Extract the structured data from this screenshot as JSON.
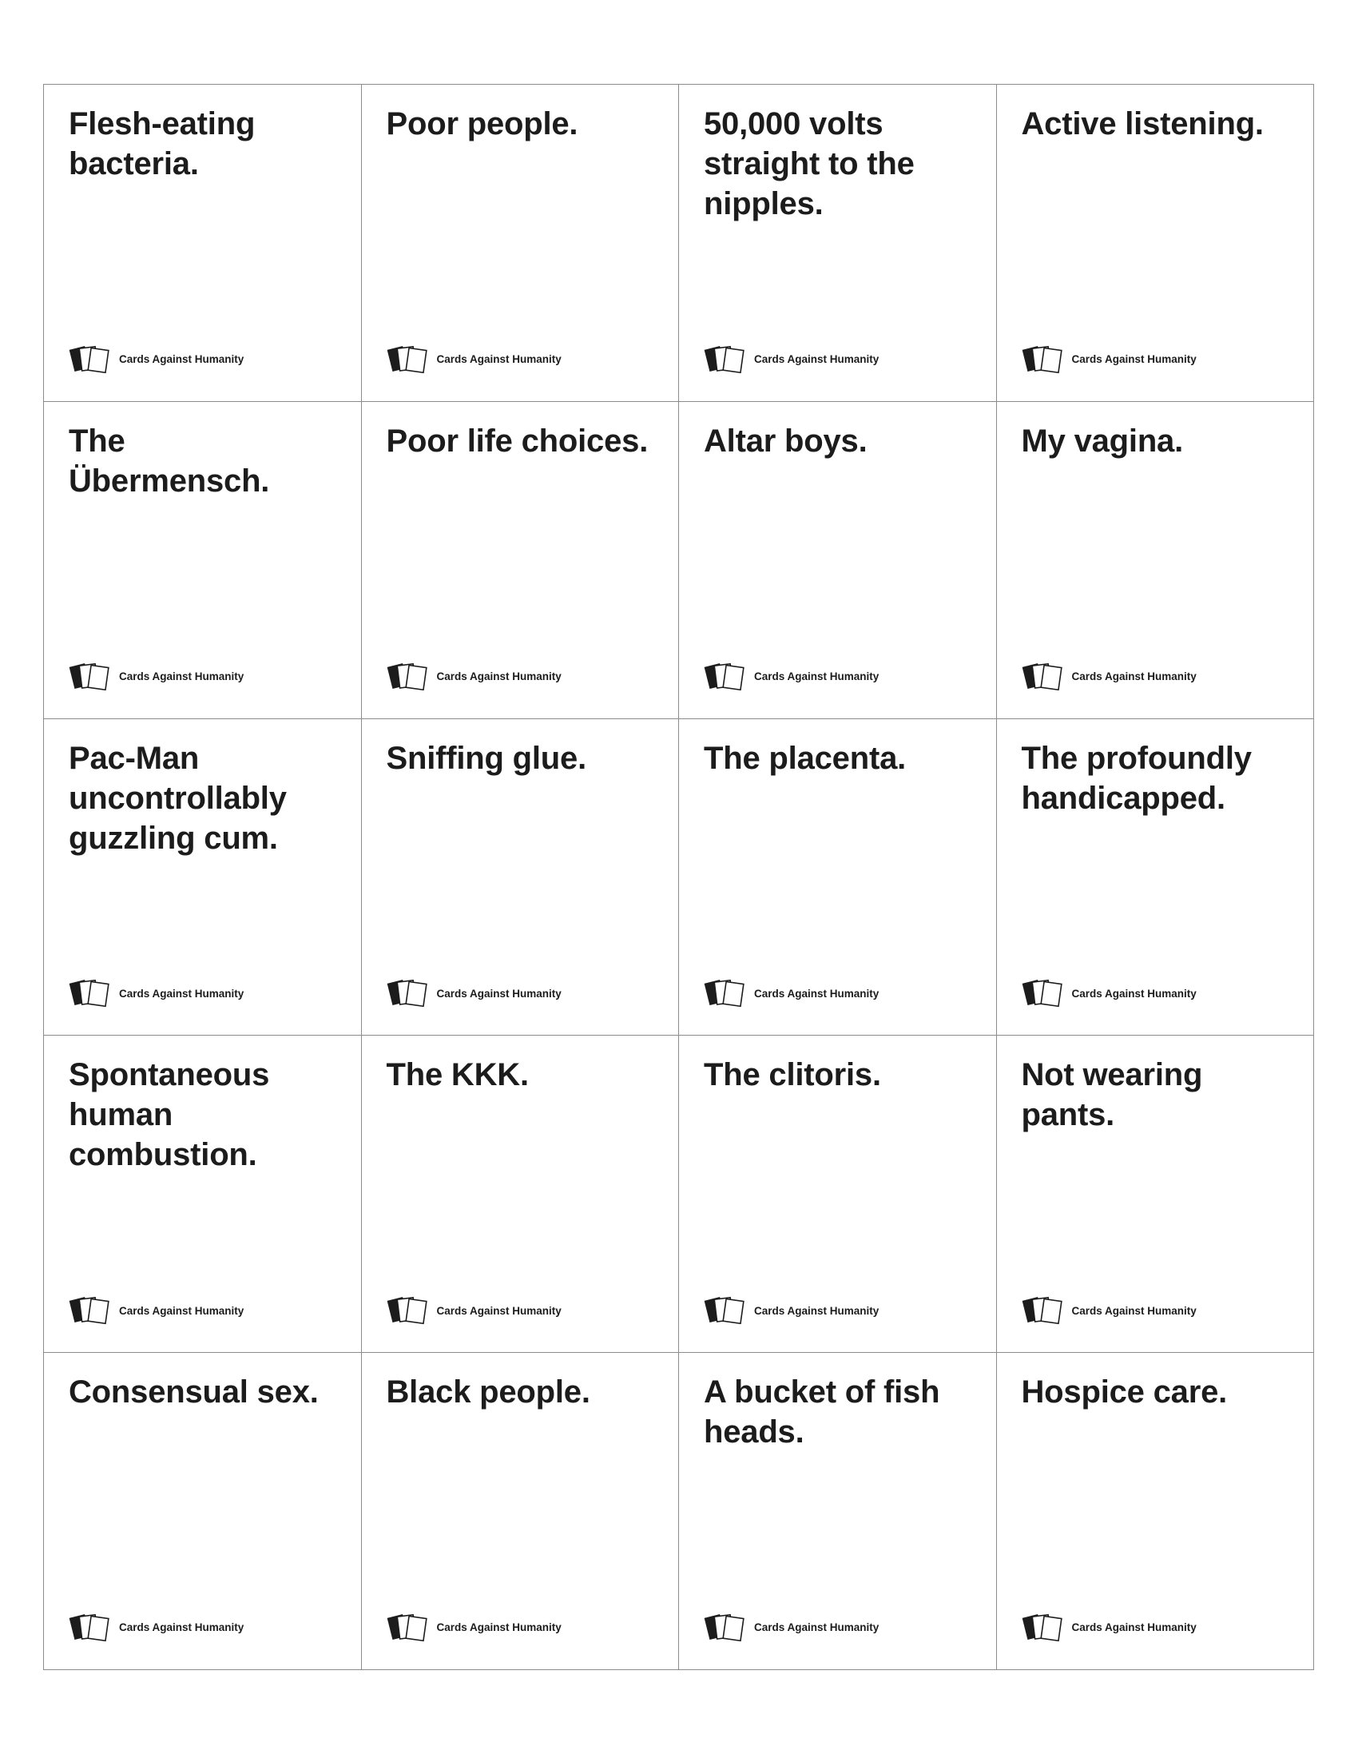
{
  "footer": {
    "brand": "Cards Against Humanity",
    "icon": "cards-stack-icon"
  },
  "cards": [
    "Flesh-eating\nbacteria.",
    "Poor people.",
    "50,000 volts\nstraight to the\nnipples.",
    "Active listening.",
    "The\nÜbermensch.",
    "Poor life choices.",
    "Altar boys.",
    "My vagina.",
    "Pac-Man\nuncontrollably\nguzzling cum.",
    "Sniffing glue.",
    "The placenta.",
    "The profoundly\nhandicapped.",
    "Spontaneous\nhuman\ncombustion.",
    "The KKK.",
    "The clitoris.",
    "Not wearing\npants.",
    "Consensual sex.",
    "Black people.",
    "A bucket of fish\nheads.",
    "Hospice care."
  ]
}
